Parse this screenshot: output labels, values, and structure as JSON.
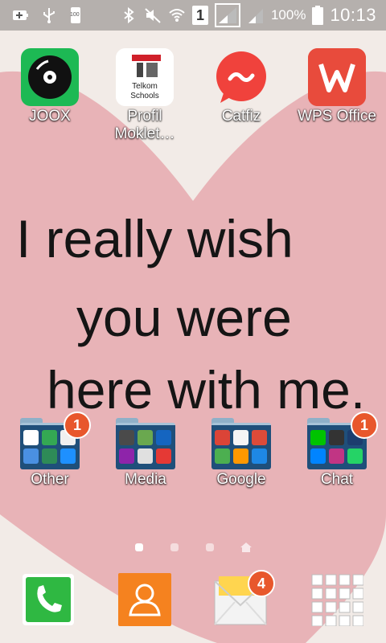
{
  "status_bar": {
    "battery_percent": "100%",
    "time": "10:13",
    "sim_slot": "1",
    "usb_battery_text": "100",
    "icons": [
      "battery-plus-icon",
      "usb-icon",
      "battery-small-icon",
      "bluetooth-icon",
      "mute-icon",
      "wifi-icon",
      "sim-icon",
      "signal-icon",
      "signal-icon-2",
      "battery-icon"
    ]
  },
  "wallpaper": {
    "line1": "I really wish",
    "line2": "you were",
    "line3": "here with me."
  },
  "apps": [
    {
      "label": "JOOX",
      "icon": "joox-icon",
      "color": "#1db954"
    },
    {
      "label": "Profil Moklet…",
      "icon": "telkom-schools-icon",
      "inner_text_1": "Telkom",
      "inner_text_2": "Schools",
      "color": "#ffffff"
    },
    {
      "label": "Catfiz",
      "icon": "catfiz-icon",
      "color": "#f0423c"
    },
    {
      "label": "WPS Office",
      "icon": "wps-office-icon",
      "color": "#e84b3c"
    }
  ],
  "folders": [
    {
      "label": "Other",
      "badge": "1"
    },
    {
      "label": "Media",
      "badge": ""
    },
    {
      "label": "Google",
      "badge": ""
    },
    {
      "label": "Chat",
      "badge": "1"
    }
  ],
  "page_indicator": {
    "pages": 3,
    "active": 0,
    "home_icon": "home-icon"
  },
  "dock": {
    "items": [
      "phone-icon",
      "contacts-icon",
      "messages-icon",
      "apps-grid-icon"
    ],
    "messages_badge": "4"
  },
  "colors": {
    "badge": "#e8572c",
    "heart": "#e8aab0",
    "folder": "#1f4f7a"
  }
}
